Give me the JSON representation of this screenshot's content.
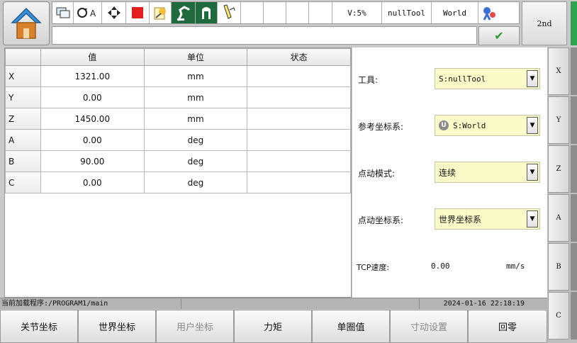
{
  "colors": {
    "home_roof": "#3a8fd6",
    "home_body": "#d9822b",
    "stop_square": "#e31f1f",
    "check": "#2f9b2f",
    "select_bg": "#fafac8",
    "green_edge": "#2fa24f"
  },
  "toolbar": {
    "home_icon": "home-icon",
    "status_icons": [
      "monitor-icon",
      "auto-mode-icon",
      "jog-arrows-icon",
      "stop-icon",
      "run-program-icon",
      "robot-arm-icon",
      "gripper-icon",
      "teach-pendant-icon"
    ],
    "speed_label": "V:5%",
    "tool_label": "nullTool",
    "frame_label": "World",
    "settings_icon": "robot-settings-icon",
    "second_label": "2nd",
    "command_value": "",
    "confirm_icon": "checkmark-icon"
  },
  "table": {
    "headers": [
      "",
      "值",
      "单位",
      "状态"
    ],
    "rows": [
      {
        "axis": "X",
        "value": "1321.00",
        "unit": "mm",
        "status": ""
      },
      {
        "axis": "Y",
        "value": "0.00",
        "unit": "mm",
        "status": ""
      },
      {
        "axis": "Z",
        "value": "1450.00",
        "unit": "mm",
        "status": ""
      },
      {
        "axis": "A",
        "value": "0.00",
        "unit": "deg",
        "status": ""
      },
      {
        "axis": "B",
        "value": "90.00",
        "unit": "deg",
        "status": ""
      },
      {
        "axis": "C",
        "value": "0.00",
        "unit": "deg",
        "status": ""
      }
    ]
  },
  "settings": {
    "tool_label": "工具:",
    "tool_value": "S:nullTool",
    "ref_label": "参考坐标系:",
    "ref_badge": "U",
    "ref_value": "S:World",
    "jog_mode_label": "点动模式:",
    "jog_mode_value": "连续",
    "jog_frame_label": "点动坐标系:",
    "jog_frame_value": "世界坐标系",
    "tcp_label": "TCP速度:",
    "tcp_value": "0.00",
    "tcp_unit": "mm/s",
    "dropdown_icon": "triangle-down-icon"
  },
  "axis_buttons": [
    "X",
    "Y",
    "Z",
    "A",
    "B",
    "C"
  ],
  "status_bar": {
    "program": "当前加载程序:/PROGRAM1/main",
    "datetime": "2024-01-16 22:18:19"
  },
  "bottom_buttons": [
    {
      "label": "关节坐标",
      "enabled": true
    },
    {
      "label": "世界坐标",
      "enabled": true
    },
    {
      "label": "用户坐标",
      "enabled": false
    },
    {
      "label": "力矩",
      "enabled": true
    },
    {
      "label": "单圈值",
      "enabled": true
    },
    {
      "label": "寸动设置",
      "enabled": false
    },
    {
      "label": "回零",
      "enabled": true
    }
  ]
}
